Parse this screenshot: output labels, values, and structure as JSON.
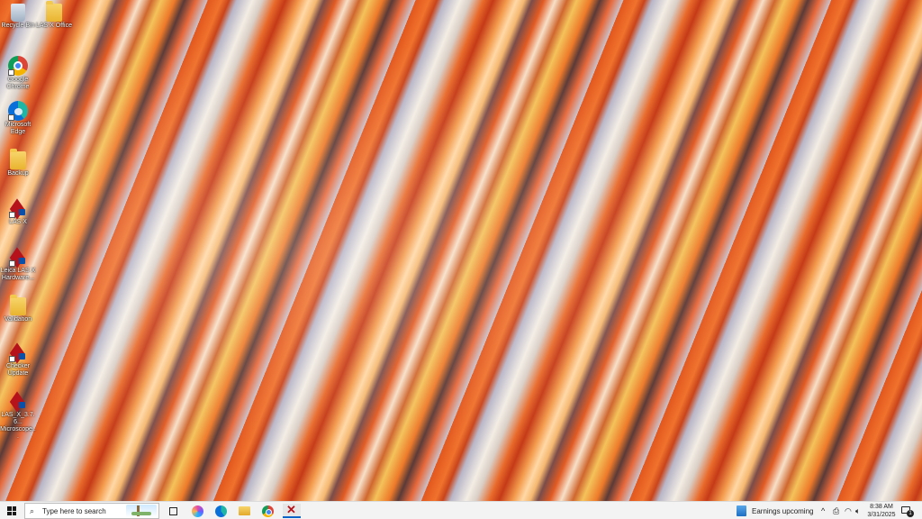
{
  "desktop": {
    "icons": [
      {
        "label": "Recycle Bin",
        "icon": "recycle-bin-icon"
      },
      {
        "label": "LAS X Office",
        "icon": "folder-icon"
      },
      {
        "label": "Google Chrome",
        "icon": "chrome-icon"
      },
      {
        "label": "Microsoft Edge",
        "icon": "edge-icon"
      },
      {
        "label": "Backup",
        "icon": "folder-icon"
      },
      {
        "label": "LAS X",
        "icon": "las-x-app-icon"
      },
      {
        "label": "Leica LAS X Hardware...",
        "icon": "leica-hardware-icon"
      },
      {
        "label": "Validation",
        "icon": "folder-icon"
      },
      {
        "label": "Checker Update",
        "icon": "checker-update-icon"
      },
      {
        "label": "LAS_X_3.7.6... Microscope...",
        "icon": "installer-icon"
      }
    ]
  },
  "taskbar": {
    "search_placeholder": "Type here to search",
    "pinned": [
      "task-view-icon",
      "copilot-icon",
      "edge-icon",
      "file-explorer-icon",
      "chrome-icon",
      "las-x-icon"
    ],
    "news": "Earnings upcoming",
    "tray": {
      "chevron": "^",
      "time": "8:38 AM",
      "date": "3/31/2025",
      "notifications": "1"
    }
  }
}
